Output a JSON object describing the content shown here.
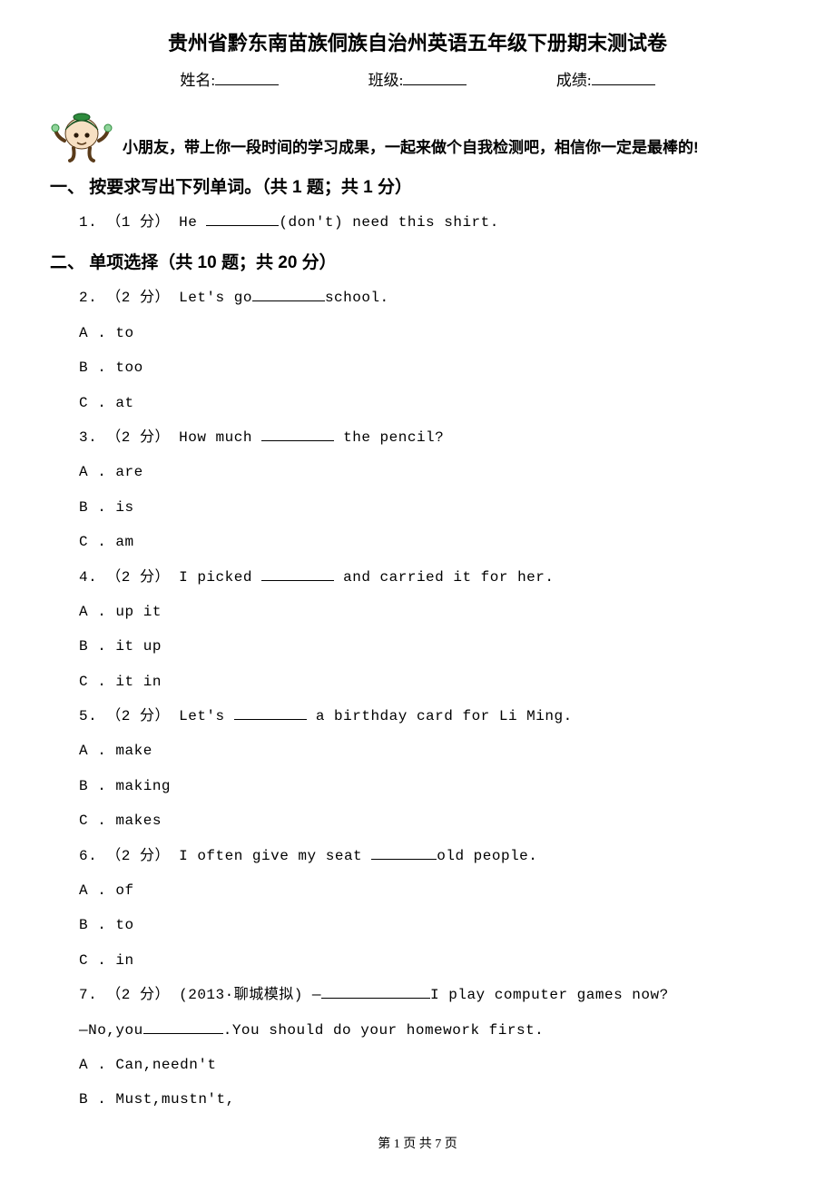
{
  "title": "贵州省黔东南苗族侗族自治州英语五年级下册期末测试卷",
  "info": {
    "name_label": "姓名:",
    "class_label": "班级:",
    "score_label": "成绩:"
  },
  "encourage": "小朋友，带上你一段时间的学习成果，一起来做个自我检测吧，相信你一定是最棒的!",
  "sections": {
    "s1": "一、 按要求写出下列单词。（共 1 题；共 1 分）",
    "s2": "二、 单项选择（共 10 题；共 20 分）"
  },
  "q1": {
    "prefix": "1. （1 分） He ",
    "suffix": "(don't) need this shirt."
  },
  "q2": {
    "stem_prefix": "2. （2 分） Let's go",
    "stem_suffix": "school.",
    "a": "A . to",
    "b": "B . too",
    "c": "C . at"
  },
  "q3": {
    "stem_prefix": "3. （2 分） How much ",
    "stem_suffix": " the pencil?",
    "a": "A . are",
    "b": "B . is",
    "c": "C . am"
  },
  "q4": {
    "stem_prefix": "4. （2 分） I picked ",
    "stem_suffix": " and carried it for her.",
    "a": "A . up it",
    "b": "B . it up",
    "c": "C . it in"
  },
  "q5": {
    "stem_prefix": "5. （2 分） Let's ",
    "stem_suffix": " a birthday card for Li Ming.",
    "a": "A . make",
    "b": "B . making",
    "c": "C . makes"
  },
  "q6": {
    "stem_prefix": "6. （2 分） I often give my seat ",
    "stem_suffix": "old people.",
    "a": "A . of",
    "b": "B . to",
    "c": "C . in"
  },
  "q7": {
    "stem_line1_prefix": "7. （2 分） (2013·聊城模拟) —",
    "stem_line1_suffix": "I play computer games now?",
    "stem_line2_prefix": "—No,you",
    "stem_line2_suffix": ".You should do your homework first.",
    "a": "A . Can,needn't",
    "b": "B . Must,mustn't,"
  },
  "footer": "第 1 页 共 7 页"
}
